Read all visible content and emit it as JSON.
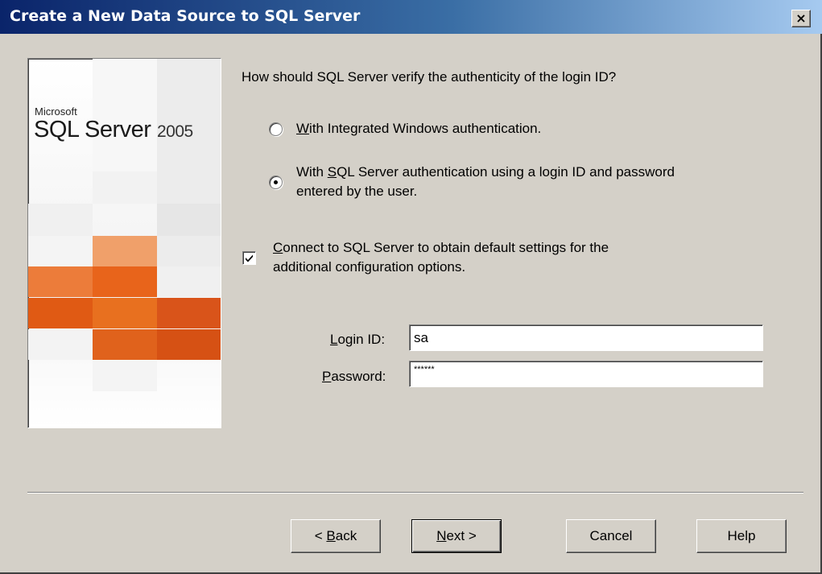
{
  "window": {
    "title": "Create a New Data Source to SQL Server",
    "close_label": "×"
  },
  "logo": {
    "company": "Microsoft",
    "product": "SQL Server",
    "version": "2005"
  },
  "auth": {
    "question": "How should SQL Server verify the authenticity of the login ID?",
    "options": [
      {
        "mnemonic": "W",
        "label_rest": "ith Integrated Windows authentication.",
        "selected": false
      },
      {
        "prefix": "With ",
        "mnemonic": "S",
        "label_rest_line1": "QL Server authentication using a login ID and password",
        "label_line2": "entered by the user.",
        "selected": true
      }
    ]
  },
  "connect_option": {
    "mnemonic": "C",
    "label_rest_line1": "onnect to SQL Server to obtain default settings for the",
    "label_line2": "additional configuration options.",
    "checked": true
  },
  "login": {
    "login_id_mnemonic": "L",
    "login_id_label_rest": "ogin ID:",
    "login_id_value": "sa",
    "password_mnemonic": "P",
    "password_label_rest": "assword:",
    "password_value": "******"
  },
  "buttons": {
    "back_prefix": "< ",
    "back_mnemonic": "B",
    "back_rest": "ack",
    "next_mnemonic": "N",
    "next_rest": "ext >",
    "cancel": "Cancel",
    "help": "Help"
  },
  "colors": {
    "title_start": "#0a246a",
    "title_end": "#a6caf0",
    "face": "#d4d0c8",
    "logo_orange": "#e8641b"
  }
}
